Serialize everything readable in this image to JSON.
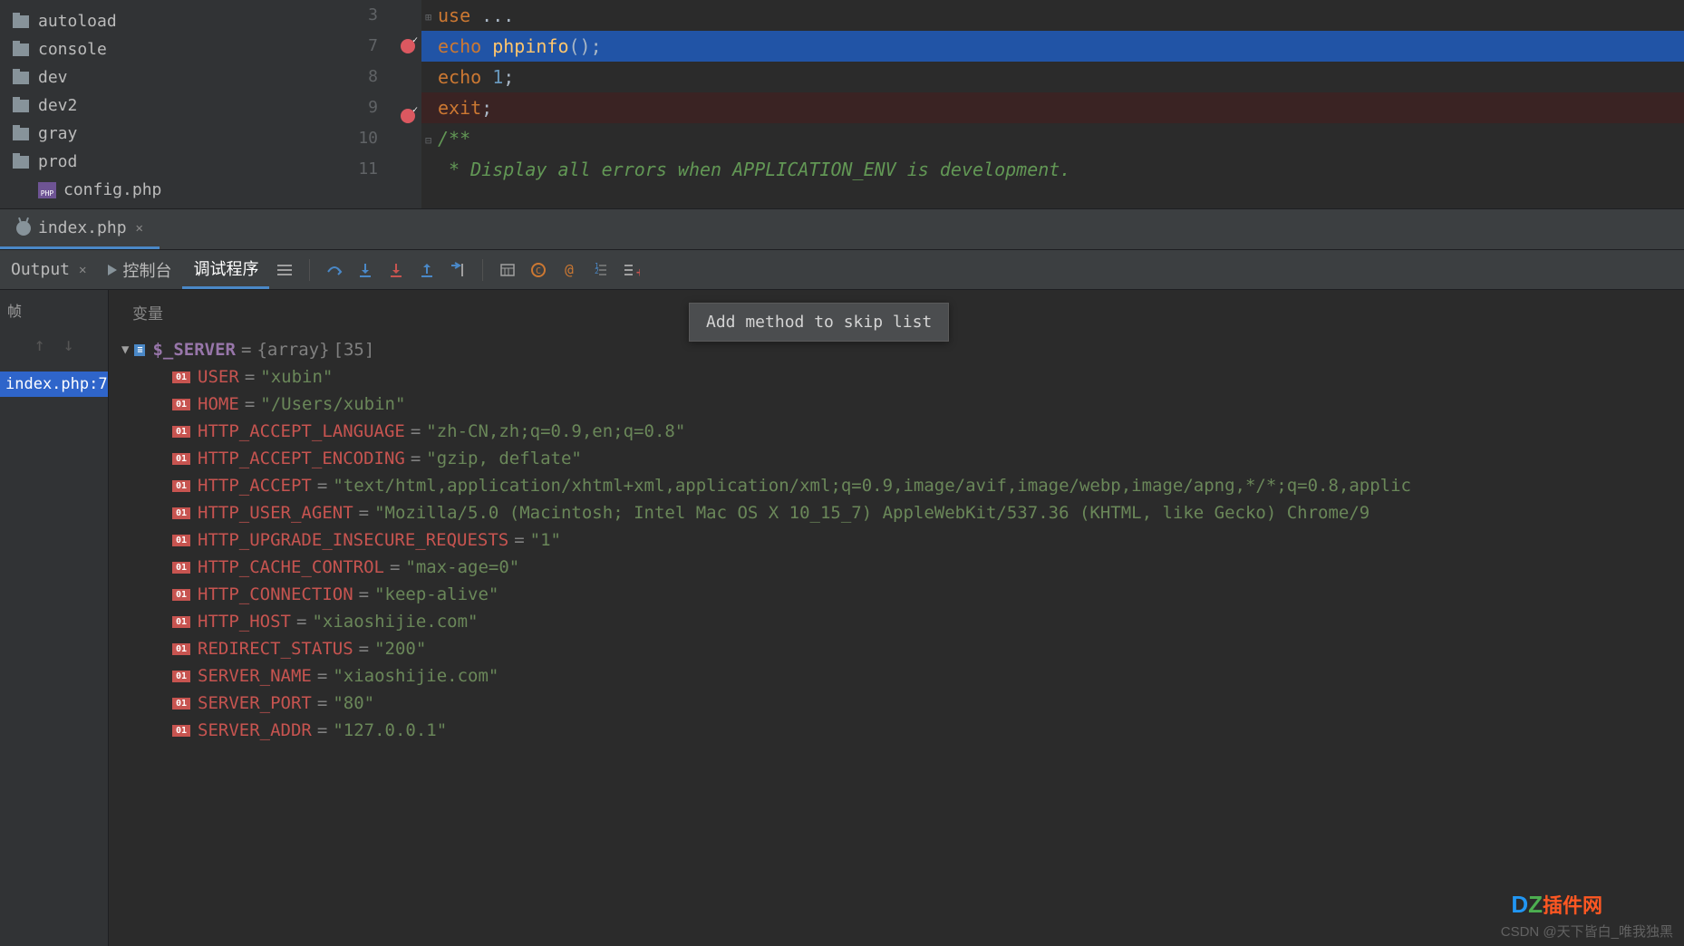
{
  "tree": {
    "folders": [
      "autoload",
      "console",
      "dev",
      "dev2",
      "gray",
      "prod"
    ],
    "file": "config.php"
  },
  "editor": {
    "lines": [
      {
        "n": "3",
        "bp": false,
        "fold": "⊞",
        "t": [
          [
            "kw",
            "use "
          ],
          [
            "txt",
            "..."
          ]
        ]
      },
      {
        "n": "7",
        "bp": true,
        "hl": "current",
        "fold": "",
        "t": [
          [
            "kw",
            "echo "
          ],
          [
            "fn",
            "phpinfo"
          ],
          [
            "txt",
            "();"
          ]
        ]
      },
      {
        "n": "8",
        "bp": false,
        "fold": "",
        "t": [
          [
            "kw",
            "echo "
          ],
          [
            "num",
            "1"
          ],
          [
            "txt",
            ";"
          ]
        ]
      },
      {
        "n": "9",
        "bp": true,
        "hl": "bp",
        "fold": "",
        "t": [
          [
            "kw",
            "exit"
          ],
          [
            "txt",
            ";"
          ]
        ]
      },
      {
        "n": "10",
        "bp": false,
        "fold": "⊟",
        "t": [
          [
            "comment",
            "/**"
          ]
        ]
      },
      {
        "n": "11",
        "bp": false,
        "fold": "",
        "t": [
          [
            "comment",
            " * Display all errors when APPLICATION_ENV is development."
          ]
        ]
      }
    ]
  },
  "debug_tab": {
    "label": "index.php"
  },
  "toolbar": {
    "output": "Output",
    "console": "控制台",
    "debugger": "调试程序"
  },
  "tooltip": "Add method to skip list",
  "frames": {
    "header": "帧",
    "item": "index.php:7"
  },
  "vars": {
    "header": "变量",
    "root": {
      "name": "$_SERVER",
      "type": "{array}",
      "count": "[35]"
    },
    "items": [
      {
        "k": "USER",
        "v": "\"xubin\""
      },
      {
        "k": "HOME",
        "v": "\"/Users/xubin\""
      },
      {
        "k": "HTTP_ACCEPT_LANGUAGE",
        "v": "\"zh-CN,zh;q=0.9,en;q=0.8\""
      },
      {
        "k": "HTTP_ACCEPT_ENCODING",
        "v": "\"gzip, deflate\""
      },
      {
        "k": "HTTP_ACCEPT",
        "v": "\"text/html,application/xhtml+xml,application/xml;q=0.9,image/avif,image/webp,image/apng,*/*;q=0.8,applic"
      },
      {
        "k": "HTTP_USER_AGENT",
        "v": "\"Mozilla/5.0 (Macintosh; Intel Mac OS X 10_15_7) AppleWebKit/537.36 (KHTML, like Gecko) Chrome/9"
      },
      {
        "k": "HTTP_UPGRADE_INSECURE_REQUESTS",
        "v": "\"1\""
      },
      {
        "k": "HTTP_CACHE_CONTROL",
        "v": "\"max-age=0\""
      },
      {
        "k": "HTTP_CONNECTION",
        "v": "\"keep-alive\""
      },
      {
        "k": "HTTP_HOST",
        "v": "\"xiaoshijie.com\""
      },
      {
        "k": "REDIRECT_STATUS",
        "v": "\"200\""
      },
      {
        "k": "SERVER_NAME",
        "v": "\"xiaoshijie.com\""
      },
      {
        "k": "SERVER_PORT",
        "v": "\"80\""
      },
      {
        "k": "SERVER_ADDR",
        "v": "\"127.0.0.1\""
      }
    ]
  },
  "watermark": "CSDN @天下皆白_唯我独黑",
  "logo": {
    "d": "D",
    "z": "Z",
    "txt": "插件网"
  }
}
